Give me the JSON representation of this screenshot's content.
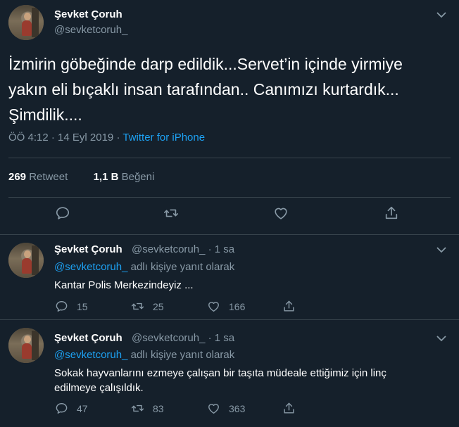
{
  "main_tweet": {
    "author_name": "Şevket Çoruh",
    "author_handle": "@sevketcoruh_",
    "text_lines": [
      "İzmirin göbeğinde darp edildik...Servet’in içinde yirmiye",
      "yakın eli bıçaklı insan tarafından.. Canımızı kurtardık...",
      "Şimdilik...."
    ],
    "time": "ÖÖ 4:12",
    "date": "14 Eyl 2019",
    "separator": "·",
    "source": "Twitter for iPhone",
    "retweet_count": "269",
    "retweet_label": "Retweet",
    "like_count": "1,1 B",
    "like_label": "Beğeni"
  },
  "replies": [
    {
      "author_name": "Şevket Çoruh",
      "author_handle": "@sevketcoruh_",
      "time_sep": "·",
      "time": "1 sa",
      "reply_mention": "@sevketcoruh_",
      "reply_suffix": "adlı kişiye yanıt olarak",
      "text": "Kantar Polis Merkezindeyiz ...",
      "reply_count": "15",
      "retweet_count": "25",
      "like_count": "166"
    },
    {
      "author_name": "Şevket Çoruh",
      "author_handle": "@sevketcoruh_",
      "time_sep": "·",
      "time": "1 sa",
      "reply_mention": "@sevketcoruh_",
      "reply_suffix": "adlı kişiye yanıt olarak",
      "text_lines": [
        "Sokak hayvanlarını ezmeye çalışan bir taşıta müdeale ettiğimiz için  linç",
        "edilmeye çalışıldık."
      ],
      "reply_count": "47",
      "retweet_count": "83",
      "like_count": "363"
    }
  ],
  "colors": {
    "background": "#15202b",
    "border": "#38444d",
    "secondary_text": "#8899a6",
    "link": "#1da1f2"
  },
  "icons": [
    "chevron-down-icon",
    "reply-icon",
    "retweet-icon",
    "like-icon",
    "share-icon"
  ]
}
